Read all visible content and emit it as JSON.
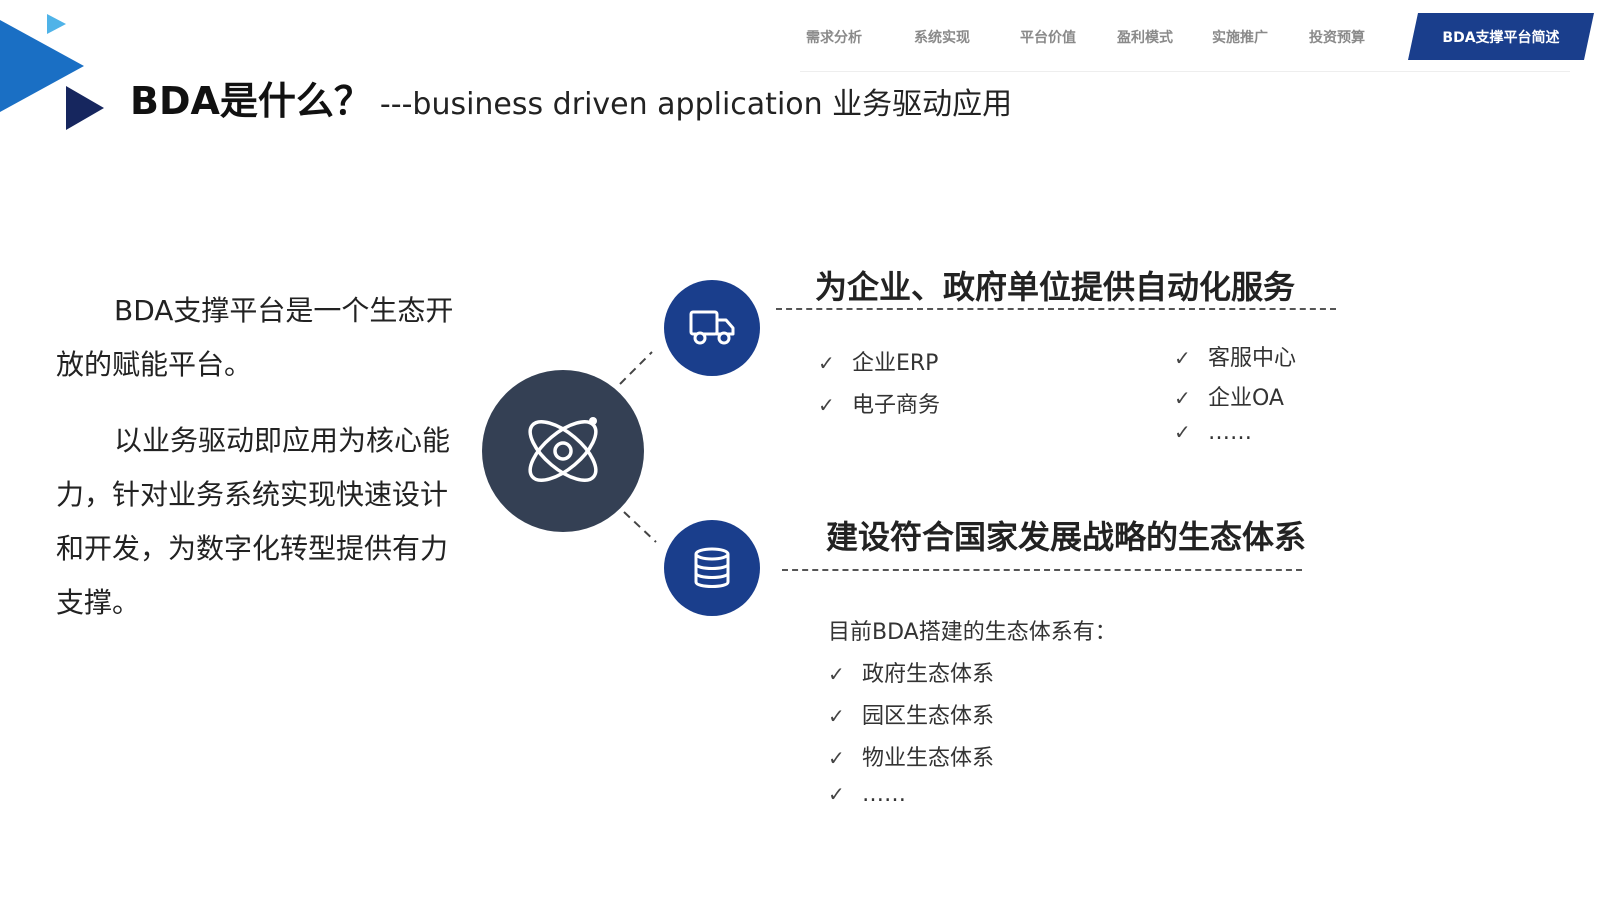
{
  "nav": {
    "items": [
      "需求分析",
      "系统实现",
      "平台价值",
      "盈利模式",
      "实施推广",
      "投资预算"
    ],
    "active": "BDA支撑平台简述",
    "active_color": "#1a3e8c"
  },
  "title": {
    "main": "BDA是什么？",
    "sub": "---business driven application  业务驱动应用"
  },
  "left": {
    "para1": "BDA支撑平台是一个生态开放的赋能平台。",
    "para2": "以业务驱动即应用为核心能力，针对业务系统实现快速设计和开发，为数字化转型提供有力支撑。"
  },
  "icons": {
    "hub": "atom-icon",
    "node1": "truck-icon",
    "node2": "database-icon"
  },
  "section1": {
    "title": "为企业、政府单位提供自动化服务",
    "col1": [
      "企业ERP",
      "电子商务"
    ],
    "col2": [
      "客服中心",
      "企业OA",
      "……"
    ]
  },
  "section2": {
    "title": "建设符合国家发展战略的生态体系",
    "intro": "目前BDA搭建的生态体系有：",
    "items": [
      "政府生态体系",
      "园区生态体系",
      "物业生态体系",
      "……"
    ]
  },
  "colors": {
    "navy": "#1a3e8c",
    "hub": "#344054",
    "accent_light": "#4fb3e8",
    "accent_blue": "#1565c0"
  }
}
